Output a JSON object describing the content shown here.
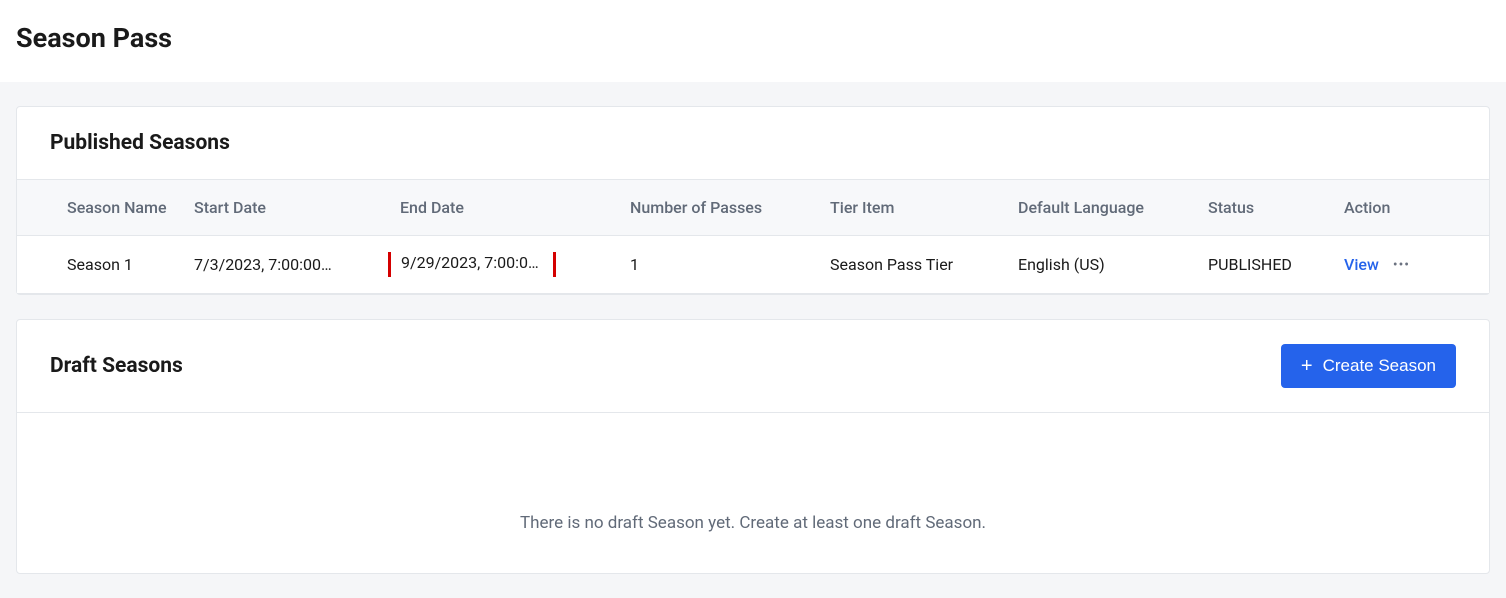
{
  "page": {
    "title": "Season Pass"
  },
  "published": {
    "title": "Published Seasons",
    "columns": {
      "name": "Season Name",
      "start": "Start Date",
      "end": "End Date",
      "passes": "Number of Passes",
      "tier": "Tier Item",
      "lang": "Default Language",
      "status": "Status",
      "action": "Action"
    },
    "rows": [
      {
        "name": "Season 1",
        "start": "7/3/2023, 7:00:00…",
        "end": "9/29/2023, 7:00:0…",
        "passes": "1",
        "tier": "Season Pass Tier",
        "lang": "English (US)",
        "status": "PUBLISHED",
        "view_label": "View"
      }
    ]
  },
  "drafts": {
    "title": "Draft Seasons",
    "create_label": "Create Season",
    "empty_message": "There is no draft Season yet. Create at least one draft Season."
  }
}
